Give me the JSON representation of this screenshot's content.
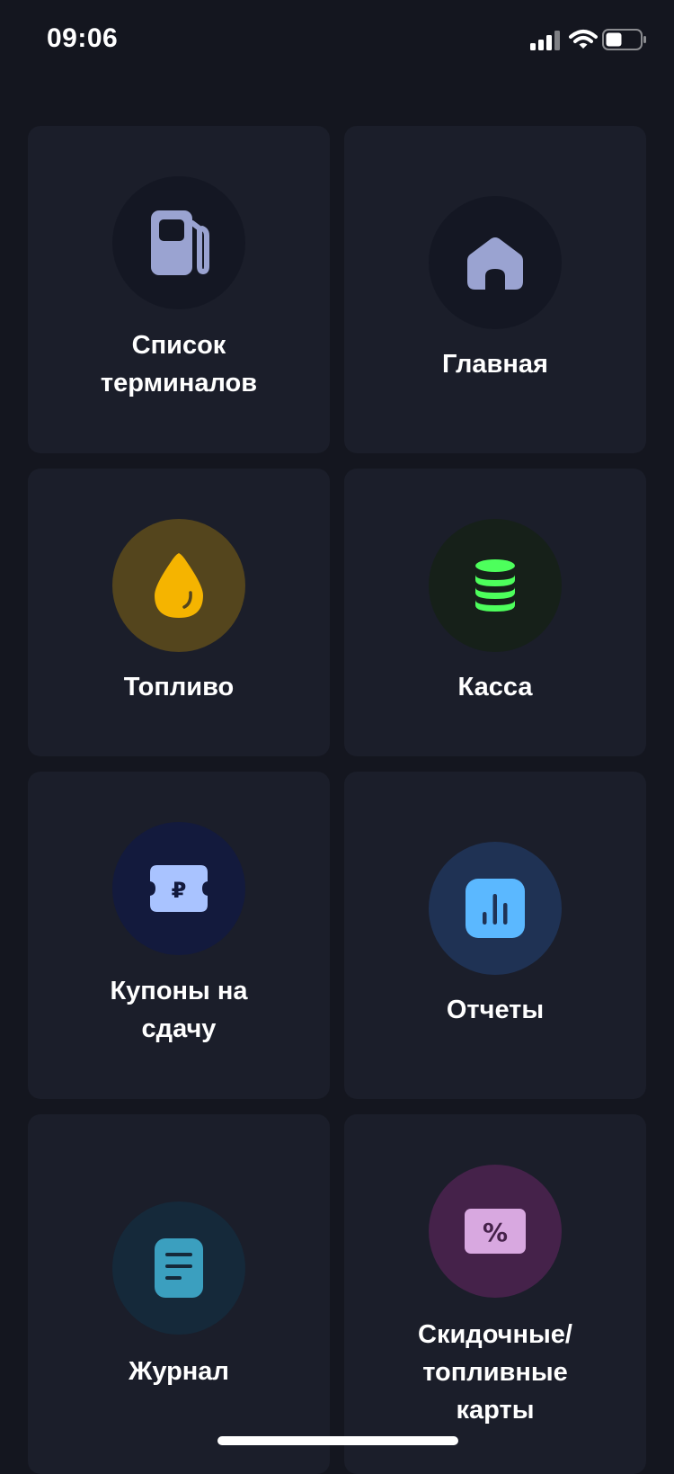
{
  "status_bar": {
    "time": "09:06"
  },
  "menu": {
    "terminals": {
      "label": "Список терминалов",
      "icon": "fuel-pump-icon",
      "circle_color": "#141723",
      "icon_color": "#9aa3d1"
    },
    "home": {
      "label": "Главная",
      "icon": "home-icon",
      "circle_color": "#141723",
      "icon_color": "#9aa3d1"
    },
    "fuel": {
      "label": "Топливо",
      "icon": "fuel-drop-icon",
      "circle_color": "#54451d",
      "icon_color": "#f5b400"
    },
    "cash": {
      "label": "Касса",
      "icon": "coin-stack-icon",
      "circle_color": "#162019",
      "icon_color": "#4dff5c"
    },
    "coupons": {
      "label": "Купоны на сдачу",
      "icon": "ruble-coupon-icon",
      "circle_color": "#131a3d",
      "icon_color": "#a9c3ff"
    },
    "reports": {
      "label": "Отчеты",
      "icon": "bar-chart-icon",
      "circle_color": "#1f3254",
      "icon_color": "#5bb8ff"
    },
    "journal": {
      "label": "Журнал",
      "icon": "document-icon",
      "circle_color": "#15293a",
      "icon_color": "#3b9fbf"
    },
    "cards": {
      "label": "Скидочные/ топливные карты",
      "icon": "discount-card-icon",
      "circle_color": "#45224a",
      "icon_color": "#d8a8e0"
    }
  }
}
